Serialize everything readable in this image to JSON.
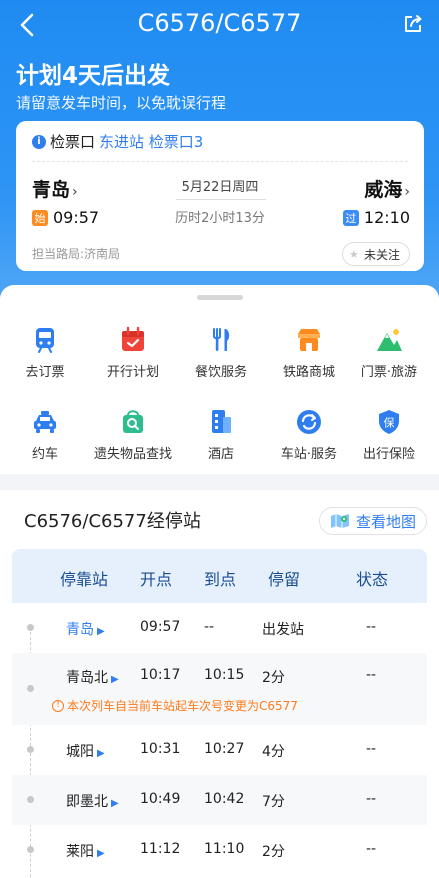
{
  "nav": {
    "title": "C6576/C6577"
  },
  "banner": {
    "headline": "计划4天后出发",
    "subline": "请留意发车时间，以免耽误行程"
  },
  "trip": {
    "gate_label": "检票口",
    "gate_value": "东进站 检票口3",
    "from_station": "青岛",
    "to_station": "威海",
    "date": "5月22日周四",
    "duration": "历时2小时13分",
    "dep_tag": "始",
    "dep_time": "09:57",
    "arr_tag": "过",
    "arr_time": "12:10",
    "bureau": "担当路局:济南局",
    "follow_label": "未关注"
  },
  "services": [
    {
      "label": "去订票",
      "icon": "train-ticket-icon",
      "color": "#2f7ef0"
    },
    {
      "label": "开行计划",
      "icon": "calendar-icon",
      "color": "#f0443a"
    },
    {
      "label": "餐饮服务",
      "icon": "fork-knife-icon",
      "color": "#2f7ef0"
    },
    {
      "label": "铁路商城",
      "icon": "shop-icon",
      "color": "#ff8a1f"
    },
    {
      "label": "门票·旅游",
      "icon": "mountain-icon",
      "color": "#2dbd6e"
    },
    {
      "label": "约车",
      "icon": "taxi-icon",
      "color": "#2f7ef0"
    },
    {
      "label": "遗失物品查找",
      "icon": "lost-bag-search-icon",
      "color": "#2dbd8f"
    },
    {
      "label": "酒店",
      "icon": "hotel-icon",
      "color": "#2f7ef0"
    },
    {
      "label": "车站·服务",
      "icon": "station-service-icon",
      "color": "#2f7ef0"
    },
    {
      "label": "出行保险",
      "icon": "insurance-shield-icon",
      "color": "#2f7ef0"
    }
  ],
  "stops": {
    "title": "C6576/C6577经停站",
    "map_label": "查看地图",
    "headers": [
      "停靠站",
      "开点",
      "到点",
      "停留",
      "状态"
    ],
    "notice": "本次列车自当前车站起车次号变更为C6577",
    "rows": [
      {
        "station": "青岛",
        "dep": "09:57",
        "arr": "--",
        "stay": "出发站",
        "status": "--"
      },
      {
        "station": "青岛北",
        "dep": "10:17",
        "arr": "10:15",
        "stay": "2分",
        "status": "--"
      },
      {
        "station": "城阳",
        "dep": "10:31",
        "arr": "10:27",
        "stay": "4分",
        "status": "--"
      },
      {
        "station": "即墨北",
        "dep": "10:49",
        "arr": "10:42",
        "stay": "7分",
        "status": "--"
      },
      {
        "station": "莱阳",
        "dep": "11:12",
        "arr": "11:10",
        "stay": "2分",
        "status": "--"
      }
    ]
  }
}
